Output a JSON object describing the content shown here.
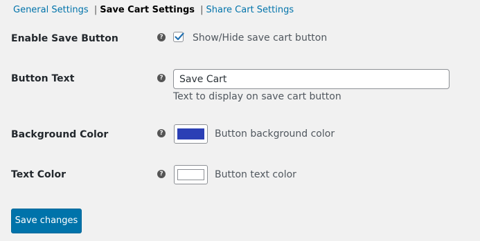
{
  "subnav": {
    "items": [
      {
        "label": "General Settings"
      },
      {
        "label": "Save Cart Settings"
      },
      {
        "label": "Share Cart Settings"
      }
    ],
    "separator": "|"
  },
  "rows": {
    "enable_save": {
      "label": "Enable Save Button",
      "help_icon": "question-circle-icon",
      "checked": true,
      "checkbox_label": "Show/Hide save cart button"
    },
    "button_text": {
      "label": "Button Text",
      "help_icon": "question-circle-icon",
      "value": "Save Cart",
      "description": "Text to display on save cart button"
    },
    "background_color": {
      "label": "Background Color",
      "help_icon": "question-circle-icon",
      "color": "#2b3fb5",
      "description": "Button background color"
    },
    "text_color": {
      "label": "Text Color",
      "help_icon": "question-circle-icon",
      "color": "#ffffff",
      "description": "Button text color"
    }
  },
  "save_button": {
    "label": "Save changes"
  },
  "colors": {
    "link": "#0073aa",
    "primary_button": "#0073aa",
    "background": "#f1f1f1"
  }
}
